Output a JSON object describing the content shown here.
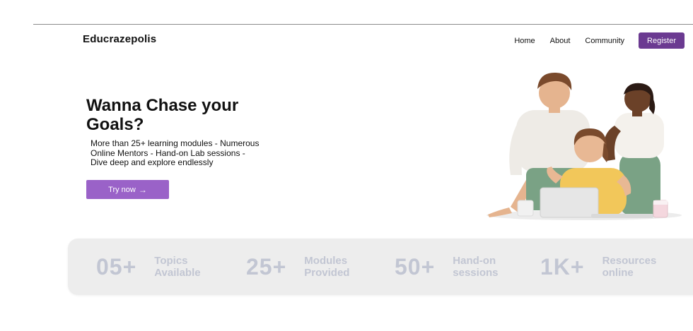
{
  "brand": "Educrazepolis",
  "nav": {
    "home": "Home",
    "about": "About",
    "community": "Community",
    "register": "Register"
  },
  "hero": {
    "title": "Wanna Chase your Goals?",
    "description": "More than 25+ learning modules - Numerous Online Mentors - Hand-on Lab sessions - Dive deep and explore endlessly",
    "cta": "Try now",
    "cta_icon": "arrow-right-icon"
  },
  "stats": [
    {
      "number": "05+",
      "label_line1": "Topics",
      "label_line2": "Available"
    },
    {
      "number": "25+",
      "label_line1": "Modules",
      "label_line2": "Provided"
    },
    {
      "number": "50+",
      "label_line1": "Hand-on",
      "label_line2": "sessions"
    },
    {
      "number": "1K+",
      "label_line1": "Resources",
      "label_line2": "online"
    }
  ],
  "colors": {
    "brand_purple": "#6b3a91",
    "button_purple": "#9a62c8",
    "stats_bg": "#ededed",
    "stats_text": "#c2c6d3"
  }
}
